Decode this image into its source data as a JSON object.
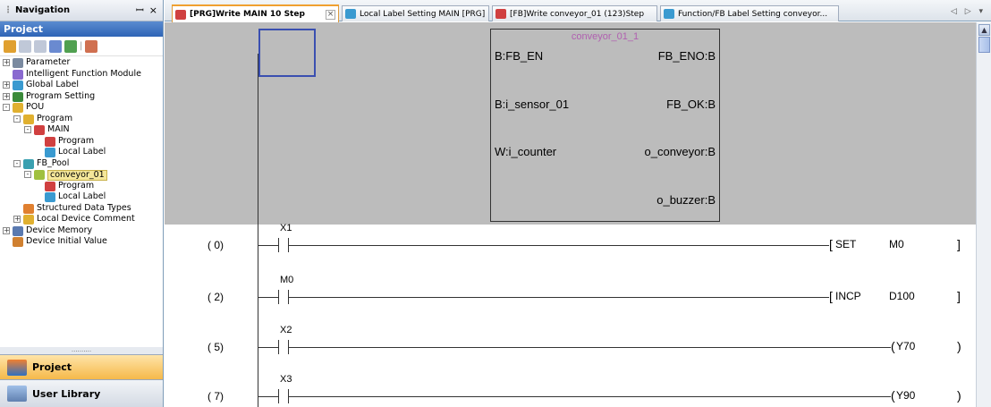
{
  "navigation": {
    "title": "Navigation",
    "pin_glyph": " ↑",
    "close_glyph": "×",
    "section_title": "Project",
    "tree": [
      {
        "label": "Parameter",
        "level": 0,
        "expander": "+",
        "icon": "parameter-icon",
        "color": "#7a8aa0"
      },
      {
        "label": "Intelligent Function Module",
        "level": 0,
        "expander": "",
        "icon": "module-icon",
        "color": "#8a6ad0"
      },
      {
        "label": "Global Label",
        "level": 0,
        "expander": "+",
        "icon": "label-icon",
        "color": "#3a9ad0"
      },
      {
        "label": "Program Setting",
        "level": 0,
        "expander": "+",
        "icon": "program-setting-icon",
        "color": "#3a8a3a"
      },
      {
        "label": "POU",
        "level": 0,
        "expander": "-",
        "icon": "folder-icon",
        "color": "#e0b030"
      },
      {
        "label": "Program",
        "level": 1,
        "expander": "-",
        "icon": "folder-icon",
        "color": "#e0b030"
      },
      {
        "label": "MAIN",
        "level": 2,
        "expander": "-",
        "icon": "program-block-icon",
        "color": "#d04040"
      },
      {
        "label": "Program",
        "level": 3,
        "expander": "",
        "icon": "ladder-icon",
        "color": "#d04040"
      },
      {
        "label": "Local Label",
        "level": 3,
        "expander": "",
        "icon": "label-icon",
        "color": "#3a9ad0"
      },
      {
        "label": "FB_Pool",
        "level": 1,
        "expander": "-",
        "icon": "folder-icon",
        "color": "#3aa0b0"
      },
      {
        "label": "conveyor_01",
        "level": 2,
        "expander": "-",
        "icon": "fb-icon",
        "color": "#a0c040",
        "selected": true
      },
      {
        "label": "Program",
        "level": 3,
        "expander": "",
        "icon": "ladder-icon",
        "color": "#d04040"
      },
      {
        "label": "Local Label",
        "level": 3,
        "expander": "",
        "icon": "label-icon",
        "color": "#3a9ad0"
      },
      {
        "label": "Structured Data Types",
        "level": 1,
        "expander": "",
        "icon": "struct-icon",
        "color": "#e08030"
      },
      {
        "label": "Local Device Comment",
        "level": 1,
        "expander": "+",
        "icon": "comment-icon",
        "color": "#e0b030"
      },
      {
        "label": "Device Memory",
        "level": 0,
        "expander": "+",
        "icon": "memory-icon",
        "color": "#5a7ab0"
      },
      {
        "label": "Device Initial Value",
        "level": 0,
        "expander": "",
        "icon": "initial-value-icon",
        "color": "#d08030"
      }
    ],
    "splitter_dots": "..........",
    "bottom_buttons": [
      {
        "label": "Project",
        "icon": "project-icon"
      },
      {
        "label": "User Library",
        "icon": "user-library-icon"
      }
    ]
  },
  "tabs": [
    {
      "label": "[PRG]Write MAIN 10 Step",
      "active": true,
      "icon": "ladder-icon",
      "close": "×"
    },
    {
      "label": "Local Label Setting MAIN [PRG]",
      "active": false,
      "icon": "label-icon"
    },
    {
      "label": "[FB]Write conveyor_01 (123)Step",
      "active": false,
      "icon": "ladder-icon"
    },
    {
      "label": "Function/FB Label Setting conveyor...",
      "active": false,
      "icon": "label-icon"
    }
  ],
  "tab_nav": "◁ ▷ ▾",
  "function_block": {
    "instance": "conveyor_01_1",
    "inputs": [
      "B:FB_EN",
      "B:i_sensor_01",
      "W:i_counter"
    ],
    "outputs": [
      "FB_ENO:B",
      "FB_OK:B",
      "o_conveyor:B",
      "o_buzzer:B"
    ]
  },
  "rungs": [
    {
      "step": "(   0)",
      "contact": "X1",
      "instruction": "SET",
      "operand": "M0",
      "type": "instr"
    },
    {
      "step": "(   2)",
      "contact": "M0",
      "instruction": "INCP",
      "operand": "D100",
      "type": "instr"
    },
    {
      "step": "(   5)",
      "contact": "X2",
      "coil": "Y70",
      "type": "coil"
    },
    {
      "step": "(   7)",
      "contact": "X3",
      "coil": "Y90",
      "type": "coil"
    }
  ]
}
